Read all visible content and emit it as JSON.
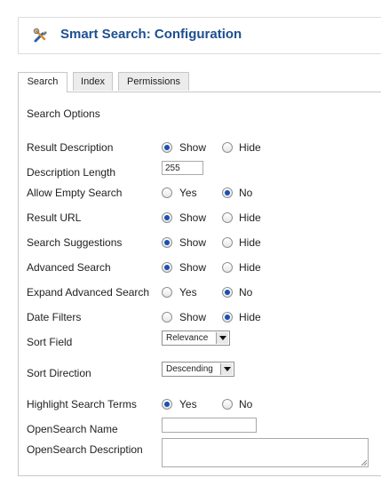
{
  "header": {
    "title": "Smart Search: Configuration",
    "icon": "tools-icon"
  },
  "tabs": [
    {
      "label": "Search",
      "active": true
    },
    {
      "label": "Index",
      "active": false
    },
    {
      "label": "Permissions",
      "active": false
    }
  ],
  "section_title": "Search Options",
  "fields": {
    "result_description": {
      "label": "Result Description",
      "options": [
        "Show",
        "Hide"
      ],
      "selected": "Show"
    },
    "description_length": {
      "label": "Description Length",
      "value": "255"
    },
    "allow_empty_search": {
      "label": "Allow Empty Search",
      "options": [
        "Yes",
        "No"
      ],
      "selected": "No"
    },
    "result_url": {
      "label": "Result URL",
      "options": [
        "Show",
        "Hide"
      ],
      "selected": "Show"
    },
    "search_suggestions": {
      "label": "Search Suggestions",
      "options": [
        "Show",
        "Hide"
      ],
      "selected": "Show"
    },
    "advanced_search": {
      "label": "Advanced Search",
      "options": [
        "Show",
        "Hide"
      ],
      "selected": "Show"
    },
    "expand_advanced_search": {
      "label": "Expand Advanced Search",
      "options": [
        "Yes",
        "No"
      ],
      "selected": "No"
    },
    "date_filters": {
      "label": "Date Filters",
      "options": [
        "Show",
        "Hide"
      ],
      "selected": "Hide"
    },
    "sort_field": {
      "label": "Sort Field",
      "value": "Relevance"
    },
    "sort_direction": {
      "label": "Sort Direction",
      "value": "Descending"
    },
    "highlight_search_terms": {
      "label": "Highlight Search Terms",
      "options": [
        "Yes",
        "No"
      ],
      "selected": "Yes"
    },
    "opensearch_name": {
      "label": "OpenSearch Name",
      "value": ""
    },
    "opensearch_description": {
      "label": "OpenSearch Description",
      "value": ""
    }
  },
  "colors": {
    "title": "#1d4f91",
    "radio_dot": "#1b4fb3",
    "border": "#c7c7c7"
  }
}
